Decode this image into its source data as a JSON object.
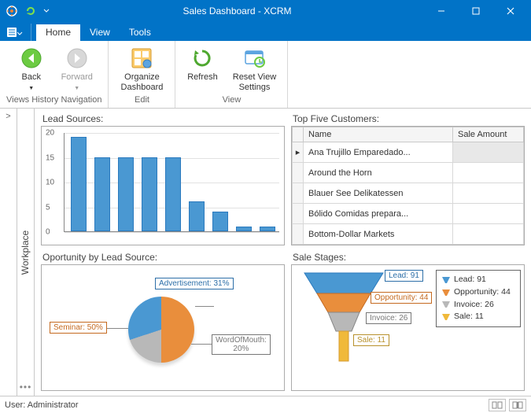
{
  "window": {
    "title": "Sales Dashboard - XCRM"
  },
  "tabs": {
    "home": "Home",
    "view": "View",
    "tools": "Tools"
  },
  "ribbon": {
    "back": "Back",
    "forward": "Forward",
    "group_nav": "Views History Navigation",
    "organize": "Organize Dashboard",
    "group_edit": "Edit",
    "refresh": "Refresh",
    "reset": "Reset View Settings",
    "group_view": "View"
  },
  "sidebar": {
    "workplace": "Workplace"
  },
  "panels": {
    "lead_sources": "Lead Sources:",
    "top_customers": "Top Five Customers:",
    "opportunity": "Oportunity by Lead Source:",
    "sale_stages": "Sale Stages:"
  },
  "table": {
    "col_name": "Name",
    "col_amount": "Sale Amount",
    "rows": [
      "Ana Trujillo Emparedado...",
      "Around the Horn",
      "Blauer See Delikatessen",
      "Bólido Comidas prepara...",
      "Bottom-Dollar Markets"
    ]
  },
  "chart_data": [
    {
      "type": "bar",
      "categories": [
        "",
        "",
        "",
        "",
        "",
        "",
        "",
        "",
        ""
      ],
      "values": [
        19,
        15,
        15,
        15,
        15,
        6,
        4,
        1,
        1
      ],
      "ylim": [
        0,
        20
      ],
      "yticks": [
        0,
        5,
        10,
        15,
        20
      ],
      "title": "Lead Sources"
    },
    {
      "type": "pie",
      "series": [
        {
          "name": "Seminar",
          "value": 50,
          "color": "#E98E3C"
        },
        {
          "name": "WordOfMouth",
          "value": 20,
          "color": "#B8B8B8"
        },
        {
          "name": "Advertisement",
          "value": 31,
          "color": "#4A98D2"
        }
      ],
      "title": "Oportunity by Lead Source"
    },
    {
      "type": "funnel",
      "series": [
        {
          "name": "Lead",
          "value": 91,
          "color": "#4A98D2"
        },
        {
          "name": "Opportunity",
          "value": 44,
          "color": "#E98E3C"
        },
        {
          "name": "Invoice",
          "value": 26,
          "color": "#B8B8B8"
        },
        {
          "name": "Sale",
          "value": 11,
          "color": "#F0B93A"
        }
      ],
      "title": "Sale Stages"
    }
  ],
  "pie_labels": {
    "seminar": "Seminar: 50%",
    "wom": "WordOfMouth: 20%",
    "ad": "Advertisement: 31%"
  },
  "funnel_labels": {
    "lead": "Lead: 91",
    "opp": "Opportunity: 44",
    "inv": "Invoice: 26",
    "sale": "Sale: 11"
  },
  "status": {
    "user": "User: Administrator"
  }
}
